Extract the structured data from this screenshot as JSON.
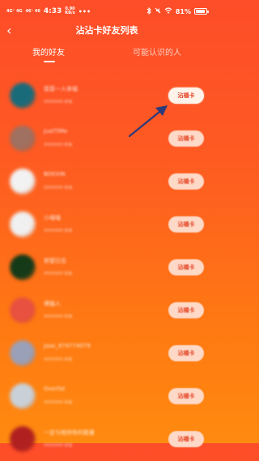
{
  "status_bar": {
    "signal1": "4G⁺ 4G",
    "signal2": "46⁺ 46",
    "time": "4:33",
    "net_speed_value": "0.90",
    "net_speed_unit": "KB/s",
    "battery_percent": "81%"
  },
  "navbar": {
    "back_label": "‹",
    "title": "沾沾卡好友列表"
  },
  "tabs": [
    {
      "label": "我的好友",
      "active": true
    },
    {
      "label": "可能认识的人",
      "active": false
    }
  ],
  "friends": [
    {
      "name": "菜菜一人幸福",
      "sub": "XXXXXXX 好友",
      "button": "沾福卡",
      "avatar_color": "#1a6b7a"
    },
    {
      "name": "JustTiMe",
      "sub": "XXXXXXX 好友",
      "button": "沾福卡",
      "avatar_color": "#a07060"
    },
    {
      "name": "BOXXIN",
      "sub": "XXXXXXX 好友",
      "button": "沾福卡",
      "avatar_color": "#f2f2f2"
    },
    {
      "name": "小喵喵",
      "sub": "XXXXXXX 好友",
      "button": "沾福卡",
      "avatar_color": "#f0f0f0"
    },
    {
      "name": "邪望日志",
      "sub": "XXXXXXX 好友",
      "button": "沾福卡",
      "avatar_color": "#153a18"
    },
    {
      "name": "博猫人",
      "sub": "XXXXXXX 好友",
      "button": "沾福卡",
      "avatar_color": "#e85040"
    },
    {
      "name": "Jase_974774079",
      "sub": "XXXXXXX 好友",
      "button": "沾福卡",
      "avatar_color": "#9aa0b8"
    },
    {
      "name": "Overfat",
      "sub": "XXXXXXX 好友",
      "button": "沾福卡",
      "avatar_color": "#c9d0d8"
    },
    {
      "name": "一定与他持有的能量",
      "sub": "XXXXXXX 好友",
      "button": "沾福卡",
      "avatar_color": "#b02020"
    }
  ],
  "colors": {
    "accent": "#fe4d29",
    "button_bg": "#ffd9c7",
    "button_text": "#e23c1b",
    "arrow": "#2b3b7a"
  }
}
